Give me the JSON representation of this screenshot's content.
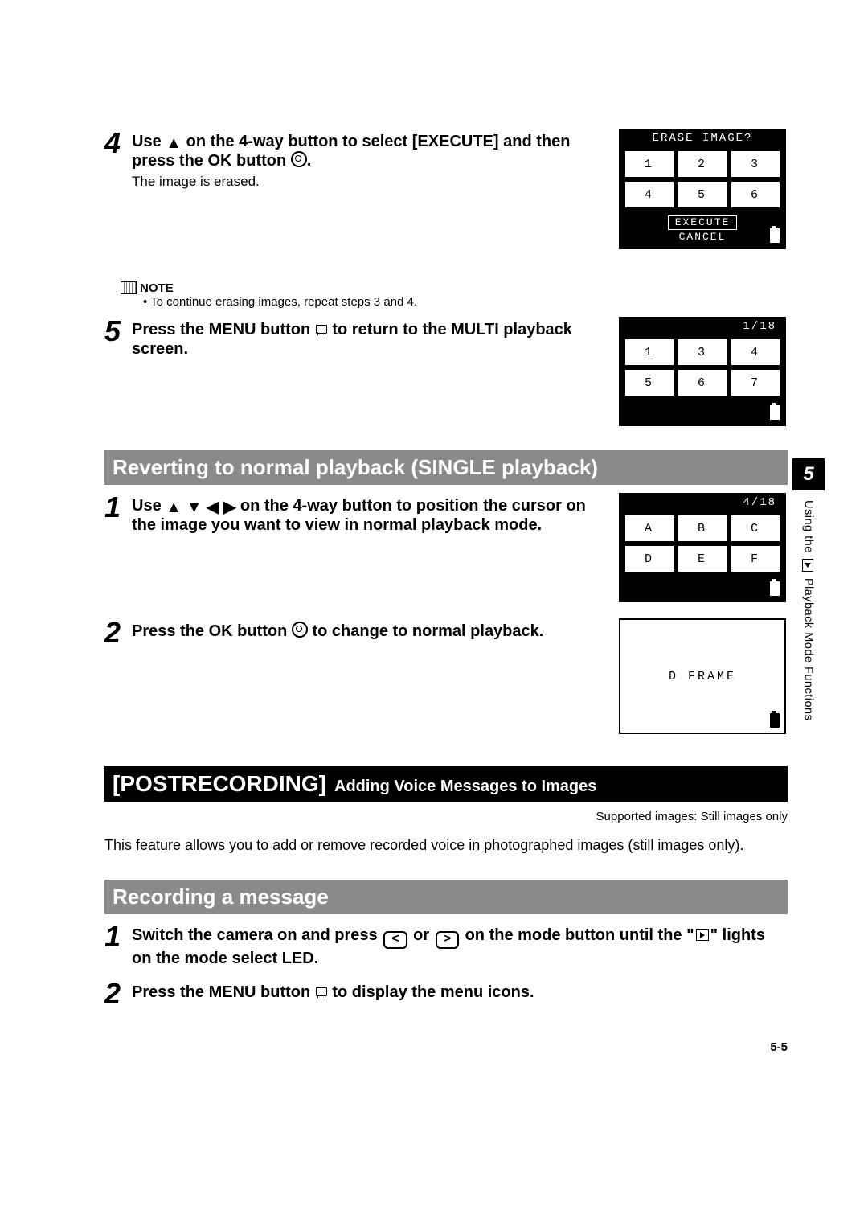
{
  "step4": {
    "title_a": "Use",
    "title_b": "on the 4-way button to select [EXECUTE] and then press the OK button",
    "period": ".",
    "text": "The image is erased."
  },
  "note": {
    "label": "NOTE",
    "text": "• To continue erasing images, repeat steps 3 and 4."
  },
  "step5": {
    "title_a": "Press the MENU button",
    "title_b": "to return to the MULTI playback screen."
  },
  "sectionA": {
    "title": "Reverting to normal playback (SINGLE playback)"
  },
  "stepA1": {
    "title_a": "Use",
    "title_b": "on the 4-way button to position the cursor on the image you want to view in normal playback mode."
  },
  "stepA2": {
    "title_a": "Press the OK button",
    "title_b": "to change to normal playback."
  },
  "blackbar": {
    "main": "[POSTRECORDING]",
    "sub": "Adding Voice Messages to Images"
  },
  "support": "Supported images: Still images only",
  "intro": "This feature allows you to add or remove recorded voice in photographed images (still images only).",
  "sectionB": {
    "title": "Recording a message"
  },
  "stepB1": {
    "title_a": "Switch the camera on and press",
    "title_b": "or",
    "title_c": "on the mode button until the \"",
    "title_d": "\" lights on the mode select LED."
  },
  "stepB2": {
    "title_a": "Press the MENU button",
    "title_b": "to display the menu icons."
  },
  "lcd1": {
    "hdr": "ERASE IMAGE?",
    "cells": [
      "1",
      "2",
      "3",
      "4",
      "5",
      "6"
    ],
    "execute": "EXECUTE",
    "cancel": "CANCEL"
  },
  "lcd2": {
    "counter": "1/18",
    "cells": [
      "1",
      "3",
      "4",
      "5",
      "6",
      "7"
    ]
  },
  "lcd3": {
    "counter": "4/18",
    "cells": [
      "A",
      "B",
      "C",
      "D",
      "E",
      "F"
    ]
  },
  "lcd4": {
    "label": "D FRAME"
  },
  "sidebar": {
    "chapter": "5",
    "text_a": "Using the",
    "text_b": "Playback Mode Functions"
  },
  "pagenum": "5-5"
}
